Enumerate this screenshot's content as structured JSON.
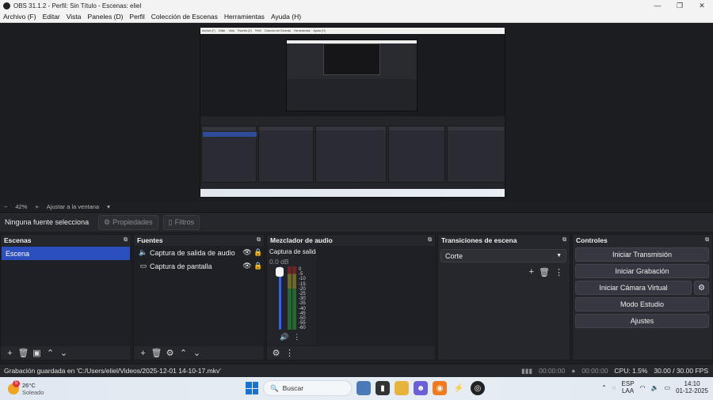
{
  "window": {
    "title": "OBS 31.1.2 - Perfil: Sin Título - Escenas: eliel",
    "controls": [
      "—",
      "❐",
      "✕"
    ]
  },
  "menu": [
    "Archivo (F)",
    "Editar",
    "Vista",
    "Paneles (D)",
    "Perfil",
    "Colección de Escenas",
    "Herramientas",
    "Ayuda (H)"
  ],
  "zoom": {
    "minus": "−",
    "value": "42%",
    "plus": "+",
    "fit_label": "Ajustar a la ventana",
    "caret": "▾"
  },
  "source_toolbar": {
    "no_source": "Ninguna fuente selecciona",
    "properties": "Propiedades",
    "filters": "Filtros"
  },
  "scenes": {
    "title": "Escenas",
    "items": [
      "Escena"
    ]
  },
  "sources": {
    "title": "Fuentes",
    "items": [
      {
        "name": "Captura de salida de audio",
        "icon": "speaker-icon"
      },
      {
        "name": "Captura de pantalla",
        "icon": "monitor-icon"
      }
    ]
  },
  "mixer": {
    "title": "Mezclador de audio",
    "channel_name": "Captura de salida d",
    "db": "0.0 dB",
    "scale": [
      "0",
      "-5",
      "-10",
      "-15",
      "-20",
      "-25",
      "-30",
      "-35",
      "-40",
      "-45",
      "-50",
      "-55",
      "-60"
    ]
  },
  "transitions": {
    "title": "Transiciones de escena",
    "selected": "Corte"
  },
  "controls": {
    "title": "Controles",
    "start_stream": "Iniciar Transmisión",
    "start_recording": "Iniciar Grabación",
    "start_virtual_cam": "Iniciar Cámara Virtual",
    "studio_mode": "Modo Estudio",
    "settings": "Ajustes"
  },
  "status": {
    "message": "Grabación guardada en 'C:/Users/eliel/Videos/2025-12-01 14-10-17.mkv'",
    "stream_time": "00:00:00",
    "rec_time": "00:00:00",
    "cpu": "CPU: 1.5%",
    "fps": "30.00 / 30.00 FPS"
  },
  "taskbar": {
    "temperature": "26°C",
    "weather": "Soleado",
    "weather_badge": "5",
    "search_placeholder": "Buscar",
    "lang_top": "ESP",
    "lang_bottom": "LAA",
    "time": "14:10",
    "date": "01-12-2025"
  },
  "mini_menu": [
    "Archivo (F)",
    "Editar",
    "Vista",
    "Paneles (D)",
    "Perfil",
    "Colección de Escenas",
    "Herramientas",
    "Ayuda (H)"
  ],
  "colors": {
    "accent": "#2c4fbf",
    "panel": "#26272c",
    "background": "#1e1f22"
  }
}
